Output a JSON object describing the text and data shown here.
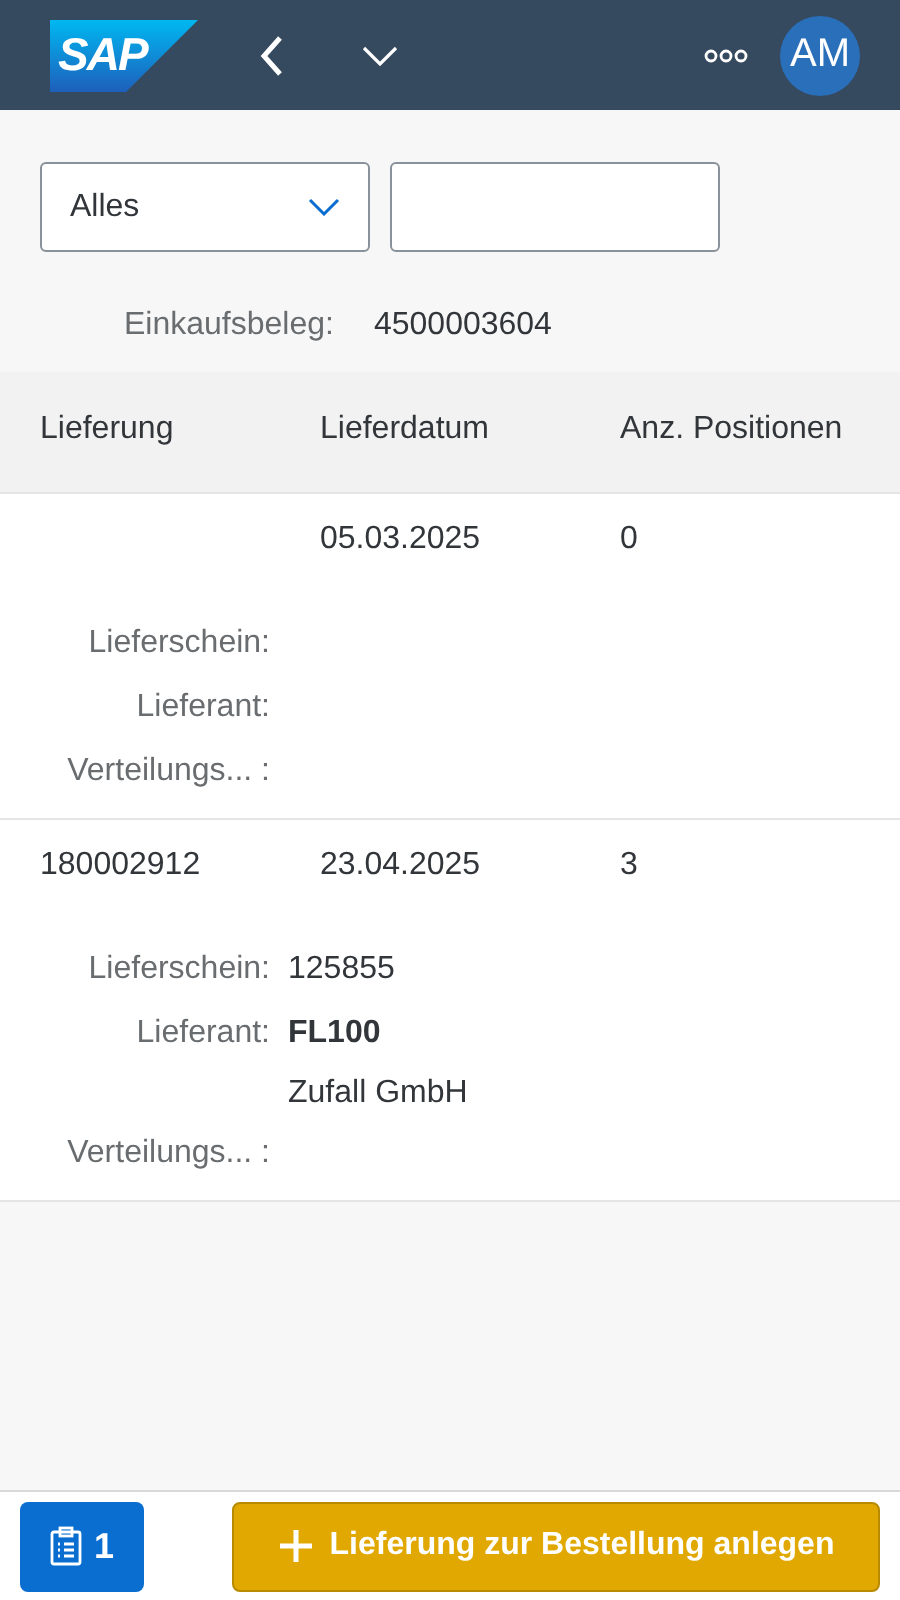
{
  "header": {
    "logo": "SAP",
    "avatar": "AM"
  },
  "filter": {
    "select_value": "Alles"
  },
  "summary": {
    "label": "Einkaufsbeleg:",
    "value": "4500003604"
  },
  "table": {
    "columns": [
      "Lieferung",
      "Lieferdatum",
      "Anz. Positionen"
    ],
    "rows": [
      {
        "cells": [
          null,
          "05.03.2025",
          "0"
        ],
        "details": [
          {
            "label": "Lieferschein:"
          },
          {
            "label": "Lieferant:"
          },
          {
            "label": "Verteilungs... :"
          }
        ]
      },
      {
        "cells": [
          "180002912",
          "23.04.2025",
          "3"
        ],
        "details": [
          {
            "label": "Lieferschein:",
            "values": [
              {
                "text": "125855",
                "bold": false
              }
            ]
          },
          {
            "label": "Lieferant:",
            "values": [
              {
                "text": "FL100",
                "bold": true
              },
              {
                "text": "Zufall GmbH",
                "bold": false
              }
            ]
          },
          {
            "label": "Verteilungs... :"
          }
        ]
      }
    ]
  },
  "footer": {
    "count": "1",
    "action": "Lieferung zur Bestellung anlegen"
  }
}
